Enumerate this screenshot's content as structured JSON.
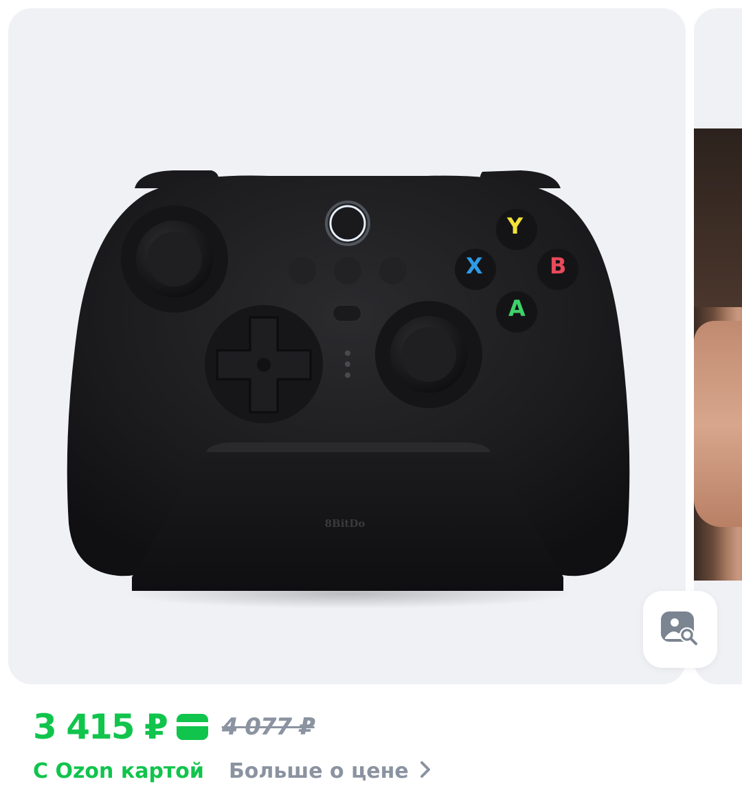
{
  "gallery": {
    "main_image_alt": "8BitDo game controller on charging dock",
    "product_brand_mark": "8BitDo",
    "controller_buttons": {
      "y": "Y",
      "x": "X",
      "b": "B",
      "a": "A"
    },
    "button_colors": {
      "y": "#f2e23a",
      "x": "#2f9be8",
      "b": "#e84a5a",
      "a": "#3fd36a"
    }
  },
  "price": {
    "current": "3 415 ₽",
    "old": "4 077 ₽",
    "with_card_label": "С Ozon картой",
    "more_link": "Больше о цене",
    "accent_color": "#10c44c",
    "muted_color": "#8b93a1"
  },
  "icons": {
    "photo_search": "image-search-icon",
    "card": "credit-card-icon",
    "chevron": "chevron-right-icon"
  }
}
